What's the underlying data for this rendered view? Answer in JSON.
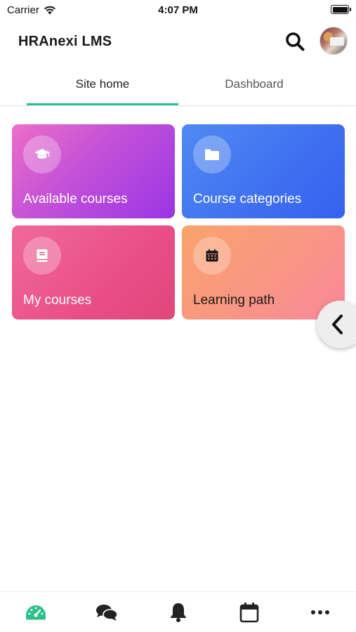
{
  "status_bar": {
    "carrier": "Carrier",
    "time": "4:07 PM"
  },
  "header": {
    "title": "HRAnexi LMS"
  },
  "tabs": [
    {
      "label": "Site home",
      "active": true
    },
    {
      "label": "Dashboard",
      "active": false
    }
  ],
  "cards": [
    {
      "label": "Available courses",
      "icon": "graduation-cap-icon"
    },
    {
      "label": "Course categories",
      "icon": "folder-icon"
    },
    {
      "label": "My courses",
      "icon": "book-icon"
    },
    {
      "label": "Learning path",
      "icon": "calendar-icon"
    }
  ],
  "bottom_nav": [
    {
      "icon": "dashboard-gauge-icon",
      "active": true
    },
    {
      "icon": "messages-icon",
      "active": false
    },
    {
      "icon": "notifications-bell-icon",
      "active": false
    },
    {
      "icon": "calendar-icon",
      "active": false
    },
    {
      "icon": "more-icon",
      "active": false
    }
  ],
  "colors": {
    "accent": "#2cc08a",
    "text": "#1a1a1a"
  }
}
